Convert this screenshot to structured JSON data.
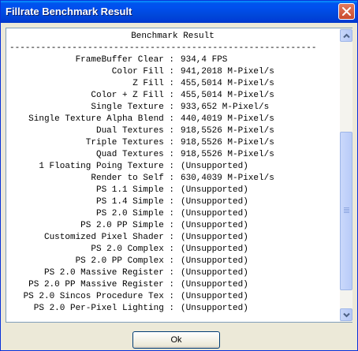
{
  "window": {
    "title": "Fillrate Benchmark Result"
  },
  "result": {
    "header": "Benchmark Result",
    "separator": "-----------------------------------------------------------",
    "rows": [
      {
        "key": "FrameBuffer Clear :",
        "value": "934,4 FPS"
      },
      {
        "key": "Color Fill :",
        "value": "941,2018 M-Pixel/s"
      },
      {
        "key": "Z Fill :",
        "value": "455,5014 M-Pixel/s"
      },
      {
        "key": "Color + Z Fill :",
        "value": "455,5014 M-Pixel/s"
      },
      {
        "key": "Single Texture :",
        "value": "933,652 M-Pixel/s"
      },
      {
        "key": "Single Texture Alpha Blend :",
        "value": "440,4019 M-Pixel/s"
      },
      {
        "key": "Dual Textures :",
        "value": "918,5526 M-Pixel/s"
      },
      {
        "key": "Triple Textures :",
        "value": "918,5526 M-Pixel/s"
      },
      {
        "key": "Quad Textures :",
        "value": "918,5526 M-Pixel/s"
      },
      {
        "key": "1 Floating Poing Texture :",
        "value": "(Unsupported)"
      },
      {
        "key": "Render to Self :",
        "value": "630,4039 M-Pixel/s"
      },
      {
        "key": "PS 1.1 Simple :",
        "value": "(Unsupported)"
      },
      {
        "key": "PS 1.4 Simple :",
        "value": "(Unsupported)"
      },
      {
        "key": "PS 2.0 Simple :",
        "value": "(Unsupported)"
      },
      {
        "key": "PS 2.0 PP Simple :",
        "value": "(Unsupported)"
      },
      {
        "key": "Customized Pixel Shader :",
        "value": "(Unsupported)"
      },
      {
        "key": "PS 2.0 Complex :",
        "value": "(Unsupported)"
      },
      {
        "key": "PS 2.0 PP Complex :",
        "value": "(Unsupported)"
      },
      {
        "key": "PS 2.0 Massive Register :",
        "value": "(Unsupported)"
      },
      {
        "key": "PS 2.0 PP Massive Register :",
        "value": "(Unsupported)"
      },
      {
        "key": "PS 2.0 Sincos Procedure Tex :",
        "value": "(Unsupported)"
      },
      {
        "key": "PS 2.0 Per-Pixel Lighting :",
        "value": "(Unsupported)"
      }
    ]
  },
  "buttons": {
    "ok": "Ok"
  },
  "icons": {
    "close": "close-icon",
    "scroll_up": "scroll-up-arrow-icon",
    "scroll_down": "scroll-down-arrow-icon",
    "thumb_grip": "grip-icon"
  },
  "colors": {
    "titlebar": "#0050ee",
    "close_button": "#d4593c",
    "frame_border": "#7f9db9",
    "scrollbar_button": "#c1d3fb",
    "ok_border": "#003c74"
  }
}
